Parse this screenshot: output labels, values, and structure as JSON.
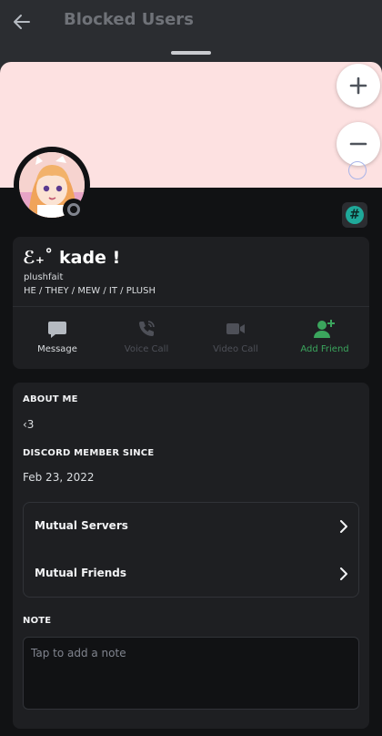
{
  "header": {
    "title": "Blocked Users",
    "back_icon": "arrow-left-icon"
  },
  "profile": {
    "banner_color": "#fde1e1",
    "display_name": "ℰ₊˚ kade !",
    "username": "plushfait",
    "pronouns": "HE / THEY / MEW / IT / PLUSH",
    "status": "offline",
    "badge_symbol": "#",
    "badge_color": "#1fa99a"
  },
  "zoom": {
    "plus_label": "+",
    "minus_label": "−"
  },
  "actions": [
    {
      "label": "Message",
      "icon": "chat-bubble-icon",
      "enabled": true
    },
    {
      "label": "Voice Call",
      "icon": "phone-call-icon",
      "enabled": false
    },
    {
      "label": "Video Call",
      "icon": "video-camera-icon",
      "enabled": false
    },
    {
      "label": "Add Friend",
      "icon": "add-friend-icon",
      "enabled": true,
      "color": "#3ba55d"
    }
  ],
  "about": {
    "title": "ABOUT ME",
    "text": "‹3",
    "member_since_title": "DISCORD MEMBER SINCE",
    "member_since": "Feb 23, 2022"
  },
  "mutuals": [
    {
      "label": "Mutual Servers"
    },
    {
      "label": "Mutual Friends"
    }
  ],
  "note": {
    "title": "NOTE",
    "placeholder": "Tap to add a note"
  }
}
